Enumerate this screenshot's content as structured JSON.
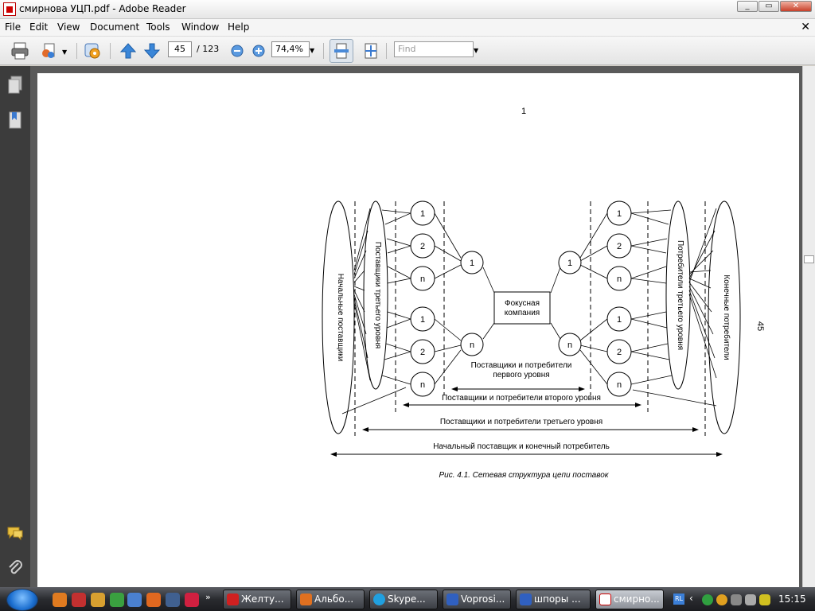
{
  "window": {
    "title": "смирнова УЦП.pdf - Adobe Reader",
    "minimize": "_",
    "maximize": "▭",
    "close": "✕"
  },
  "menu": {
    "items": [
      "File",
      "Edit",
      "View",
      "Document",
      "Tools",
      "Window",
      "Help"
    ],
    "close_doc": "✕"
  },
  "toolbar": {
    "page_current": "45",
    "page_total": "/ 123",
    "zoom": "74,4%",
    "find_placeholder": "Find"
  },
  "document": {
    "header_number": "1",
    "side_page_number": "45",
    "figure": {
      "caption": "Рис. 4.1. Сетевая структура цепи поставок",
      "focal": [
        "Фокусная",
        "компания"
      ],
      "left_outer_label": "Начальные поставщики",
      "left_inner_label": "Поставщики третьего уровня",
      "right_inner_label": "Потребители третьего уровня",
      "right_outer_label": "Конечные потребители",
      "level1_label": [
        "Поставщики и потребители",
        "первого уровня"
      ],
      "level2_label": "Поставщики и потребители второго уровня",
      "level3_label": "Поставщики и потребители третьего уровня",
      "level4_label": "Начальный поставщик и конечный потребитель",
      "node_labels": [
        "1",
        "2",
        "n",
        "1",
        "2",
        "n"
      ],
      "tier1_labels": [
        "1",
        "n"
      ]
    }
  },
  "taskbar": {
    "tasks": [
      "Желту...",
      "Альбо...",
      "Skype...",
      "Voprosi...",
      "шпоры ...",
      "смирно..."
    ],
    "lang": "RL",
    "clock": "15:15"
  }
}
